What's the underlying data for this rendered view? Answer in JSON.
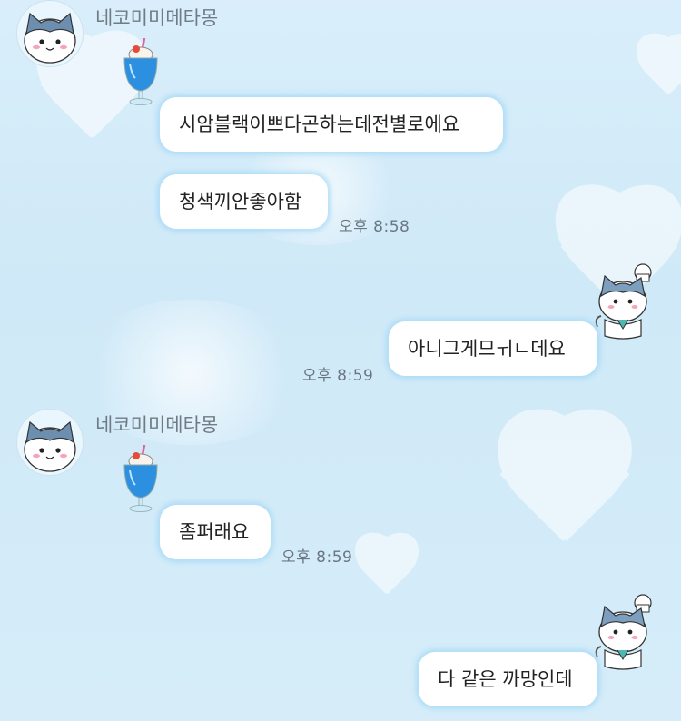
{
  "messages": [
    {
      "sender": "네코미미메타몽",
      "text": "시암블랙이쁘다곤하는데전별로에요"
    },
    {
      "text": "청색끼안좋아함",
      "time": "오후 8:58"
    },
    {
      "text": "아니그게므ㅟㄴ데요",
      "time": "오후 8:59"
    },
    {
      "sender": "네코미미메타몽",
      "text": "좀퍼래요",
      "time": "오후 8:59"
    },
    {
      "text": "다 같은 까망인데"
    }
  ],
  "icons": {
    "sender_avatar": "hachiware-cat-avatar-icon",
    "sender_sticker": "blue-cream-soda-icon",
    "self_avatar": "chef-cat-avatar-icon"
  },
  "colors": {
    "background": "#d4ecf9",
    "bubble": "#ffffff",
    "bubble_glow": "#a0d7f5",
    "name_text": "#6f7c86"
  }
}
